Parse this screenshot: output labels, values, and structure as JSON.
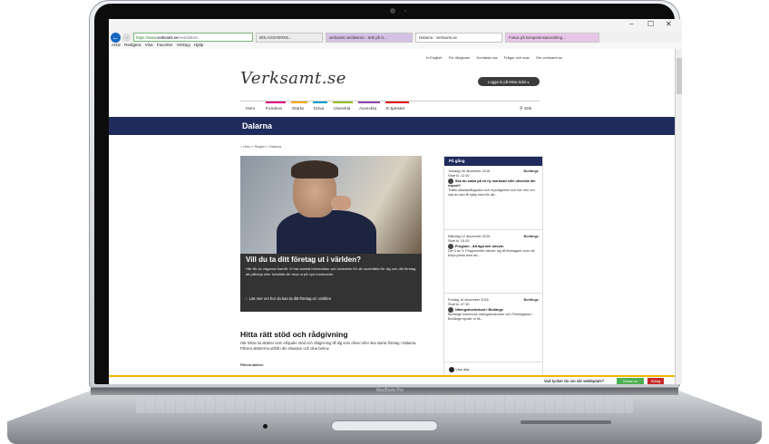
{
  "browser": {
    "url": {
      "secure_label": "https://www.",
      "host": "verksamt.se",
      "rest": "/web/dalarn"
    },
    "tabs": [
      {
        "label": "BOLAGSVERKE...",
        "color": "#ececec"
      },
      {
        "label": "verksamt.se/dalarna - Sök på G...",
        "color": "#d6c1e6"
      },
      {
        "label": "Dalarna - verksamt.se",
        "color": "#ffffff"
      },
      {
        "label": "Fokus på kompetensutveckling...",
        "color": "#e8c6e8"
      }
    ],
    "menu": [
      "Arkiv",
      "Redigera",
      "Visa",
      "Favoriter",
      "Verktyg",
      "Hjälp"
    ],
    "win_min": "−",
    "win_max": "☐",
    "win_close": "✕"
  },
  "site": {
    "toplinks": [
      "In English",
      "För rådgivare",
      "Kontakta oss",
      "Frågor och svar",
      "Om verksamt.se"
    ],
    "logo": "Verksamt.se",
    "login": "Logga in på Mina sidor",
    "nav": [
      {
        "label": "Hem",
        "color": ""
      },
      {
        "label": "Fundera",
        "color": "#e6007e"
      },
      {
        "label": "Starta",
        "color": "#f7a600"
      },
      {
        "label": "Driva",
        "color": "#00a0c6"
      },
      {
        "label": "Utveckla",
        "color": "#95c11f"
      },
      {
        "label": "Avveckla",
        "color": "#8e44ad"
      },
      {
        "label": "E-tjänster",
        "color": "#e30613"
      }
    ],
    "search": "Sök",
    "region_title": "Dalarna",
    "breadcrumb": "Hem » Region » Dalarna"
  },
  "hero": {
    "title": "Vill du ta ditt företag ut i världen?",
    "text": "Här får du vägarna framåt. Vi har samlat information och kontakter för att underlätta för dig och ditt företag att påbörja eller fortsätta din resa ut på nya marknader.",
    "link": "Läs mer om hur du kan ta ditt företag ut i världen"
  },
  "section": {
    "title": "Hitta rätt stöd och rådgivning",
    "text": "Här hittar du aktörer som erbjuder stöd och rådgivning till dig som driver eller ska starta företag i Dalarna. Filtrera aktörerna utifrån din situation och dina behov.",
    "filter": "Filtrera aktörer"
  },
  "events": {
    "heading": "På gång",
    "items": [
      {
        "date": "Torsdag 08 december 2016",
        "city": "Borlänge",
        "time": "Start kl. 12.00",
        "title": "Ska du satsa på en ny marknad eller utveckla din export?",
        "desc": "Träffa utlandsrådgivare och myndigheter och hör mer om vad du kan få hjälp med för att..."
      },
      {
        "date": "Måndag 12 december 2016",
        "city": "Borlänge",
        "time": "Start kl. 15.00",
        "title": "Program - Att äga mer ansvar.",
        "desc": "Del 3 av 3: Programmet vänder sig till företagare som vill börja jobba med att..."
      },
      {
        "date": "Fredag 16 december 2016",
        "city": "Borlänge",
        "time": "Start kl. 07.30",
        "title": "Näringslivsfrukost i Borlänge",
        "desc": "Borlänge kommuns näringslivskontor och Företagarna i Borlänge bjuder in till..."
      }
    ],
    "see_all": "Visa alla"
  },
  "feedback": {
    "question": "Vad tycker du om vår webbplats?",
    "yes": "Svara nu",
    "close": "Stäng"
  },
  "laptop": {
    "brand": "MacBook Pro"
  }
}
